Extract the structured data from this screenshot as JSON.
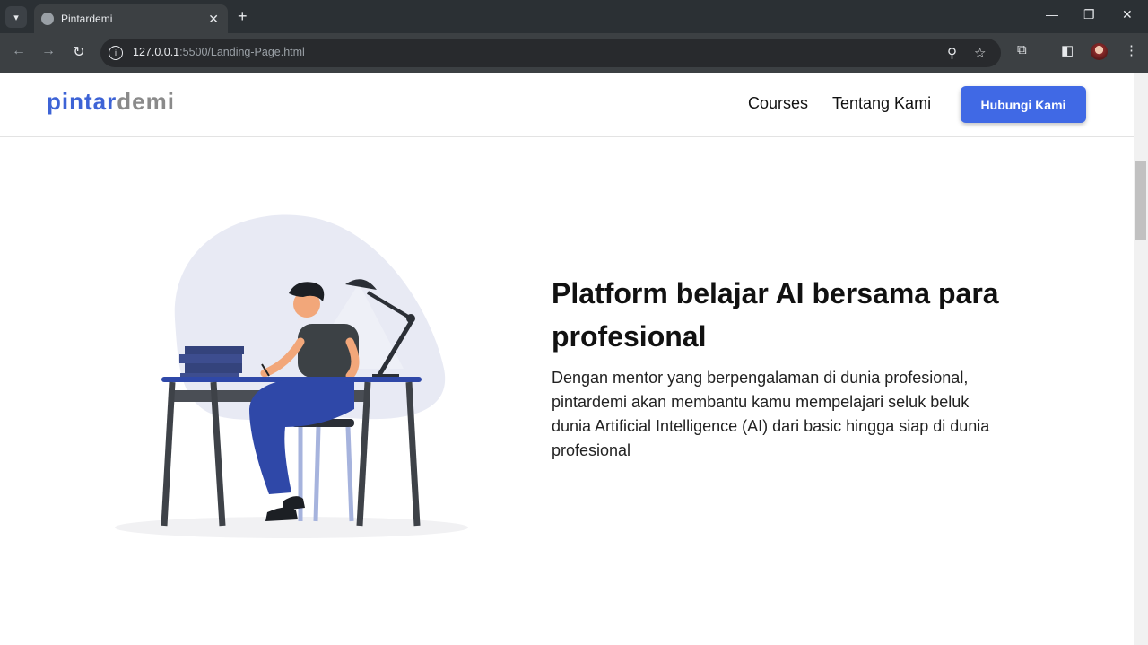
{
  "browser": {
    "tab_title": "Pintardemi",
    "close_tab": "✕",
    "new_tab": "+",
    "url_host": "127.0.0.1",
    "url_path": ":5500/Landing-Page.html",
    "window_minimize": "—",
    "window_restore": "❐",
    "window_close": "✕"
  },
  "header": {
    "logo_part1": "pintar",
    "logo_part2": "demi",
    "nav": [
      "Courses",
      "Tentang Kami"
    ],
    "cta_label": "Hubungi Kami"
  },
  "hero": {
    "title": "Platform belajar AI bersama para profesional",
    "description": "Dengan mentor yang berpengalaman di dunia profesional, pintardemi akan membantu kamu mempelajari seluk beluk dunia Artificial Intelligence (AI) dari basic hingga siap di dunia profesional"
  },
  "colors": {
    "accent": "#4069e5",
    "logo_gray": "#8a8a8a",
    "illustration_blob": "#e8eaf4"
  }
}
